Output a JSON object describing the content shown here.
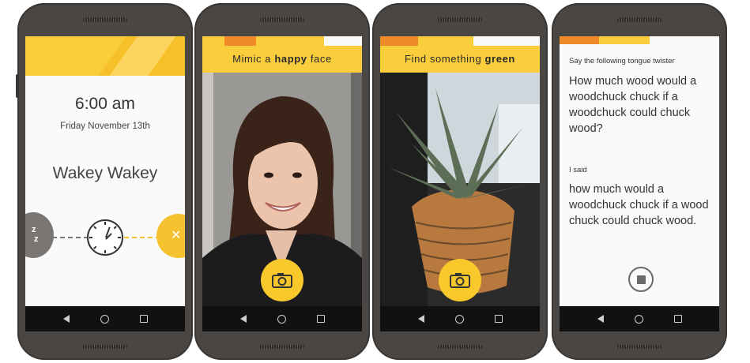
{
  "colors": {
    "accent_yellow": "#f9cd3c",
    "accent_orange": "#ef8a2b",
    "phone_body": "#4a4644",
    "nav_bar": "#111111"
  },
  "alarm": {
    "time": "6:00 am",
    "date": "Friday November 13th",
    "greeting": "Wakey Wakey",
    "snooze_label": "z z",
    "dismiss_label": "✕"
  },
  "face_challenge": {
    "prefix": "Mimic a",
    "emphasis": "happy",
    "suffix": "face"
  },
  "color_challenge": {
    "prefix": "Find something",
    "emphasis": "green"
  },
  "speech_challenge": {
    "instruction": "Say the following tongue twister",
    "tongue_twister": "How much wood would a woodchuck chuck if a woodchuck could chuck wood?",
    "said_label": "I said",
    "transcript": "how much would a woodchuck chuck if a wood chuck could chuck wood."
  },
  "icons": {
    "camera": "camera-icon",
    "stop": "stop-icon",
    "clock": "alarm-clock-icon"
  }
}
